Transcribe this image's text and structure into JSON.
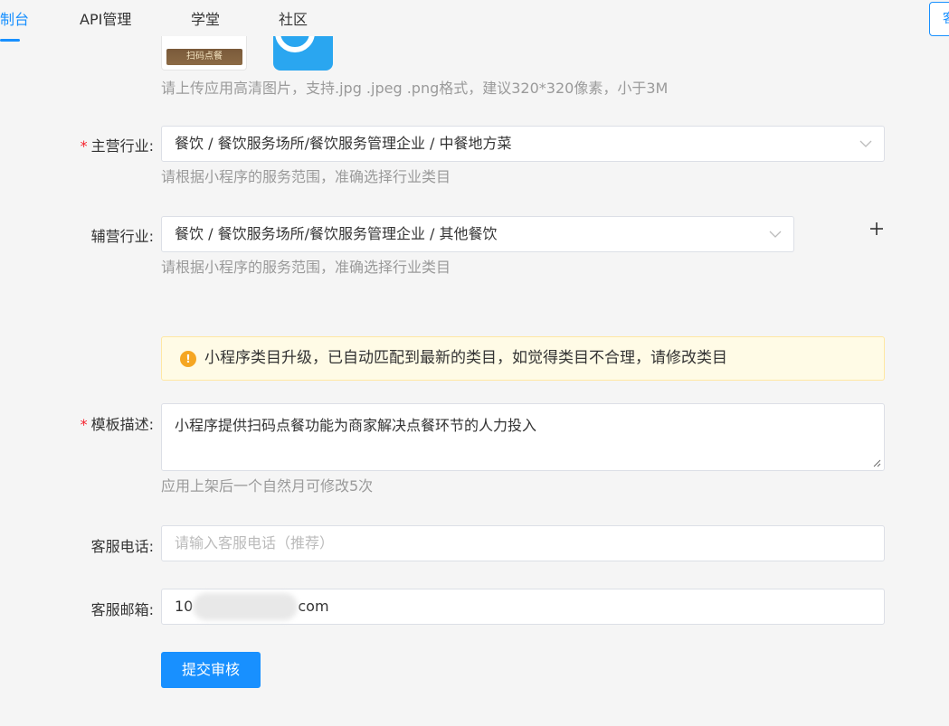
{
  "nav": {
    "tabs": [
      {
        "label": "制台",
        "active": true
      },
      {
        "label": "API管理",
        "active": false
      },
      {
        "label": "学堂",
        "active": false
      },
      {
        "label": "社区",
        "active": false
      }
    ],
    "right_button": "客"
  },
  "upload": {
    "thumb_caption": "扫码点餐",
    "hint": "请上传应用高清图片，支持.jpg .jpeg .png格式，建议320*320像素，小于3M"
  },
  "primary_industry": {
    "required_mark": "*",
    "label": "主营行业:",
    "value": "餐饮 / 餐饮服务场所/餐饮服务管理企业 / 中餐地方菜",
    "hint": "请根据小程序的服务范围，准确选择行业类目"
  },
  "secondary_industry": {
    "label": "辅营行业:",
    "value": "餐饮 / 餐饮服务场所/餐饮服务管理企业 / 其他餐饮",
    "hint": "请根据小程序的服务范围，准确选择行业类目"
  },
  "alert": {
    "icon": "!",
    "text": "小程序类目升级，已自动匹配到最新的类目，如觉得类目不合理，请修改类目"
  },
  "template_desc": {
    "required_mark": "*",
    "label": "模板描述:",
    "value": "小程序提供扫码点餐功能为商家解决点餐环节的人力投入",
    "hint": "应用上架后一个自然月可修改5次"
  },
  "service_phone": {
    "label": "客服电话:",
    "placeholder": "请输入客服电话（推荐）"
  },
  "service_email": {
    "label": "客服邮箱:",
    "value_prefix": "10",
    "value_suffix": "com"
  },
  "submit_label": "提交审核",
  "colors": {
    "primary": "#1890ff",
    "required": "#f5222d",
    "warning": "#f5a623",
    "alert_bg": "#fffbe6"
  }
}
